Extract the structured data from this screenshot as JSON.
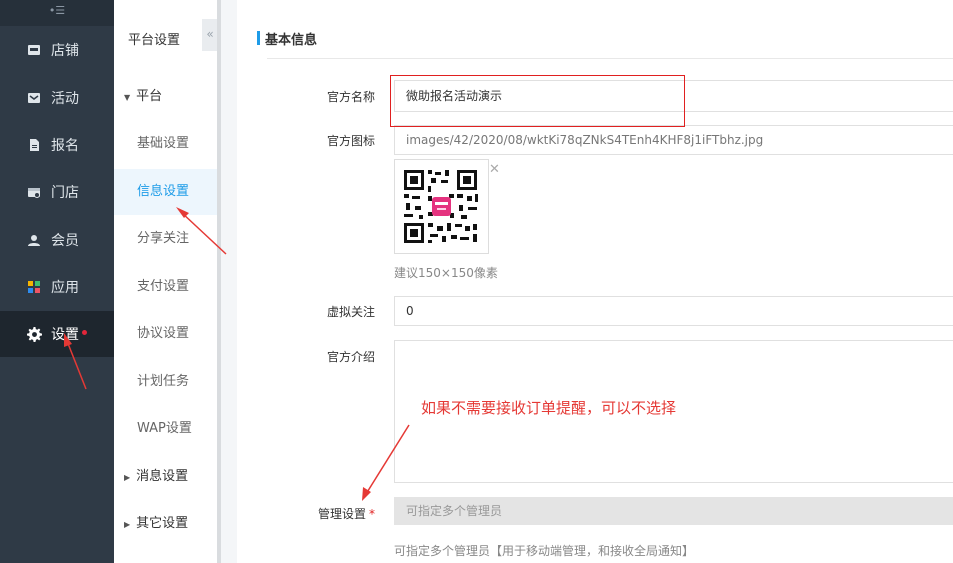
{
  "nav": {
    "collapse_label": "•☰",
    "items": [
      {
        "label": "店铺",
        "icon": "shop-icon"
      },
      {
        "label": "活动",
        "icon": "activity-icon"
      },
      {
        "label": "报名",
        "icon": "signup-icon"
      },
      {
        "label": "门店",
        "icon": "store-icon"
      },
      {
        "label": "会员",
        "icon": "member-icon"
      },
      {
        "label": "应用",
        "icon": "apps-icon"
      },
      {
        "label": "设置",
        "icon": "gear-icon",
        "active": true
      }
    ]
  },
  "submenu": {
    "title": "平台设置",
    "collapse_glyph": "«",
    "group_platform": "平台",
    "items": [
      "基础设置",
      "信息设置",
      "分享关注",
      "支付设置",
      "协议设置",
      "计划任务",
      "WAP设置"
    ],
    "active_index": 1,
    "group_message": "消息设置",
    "group_other": "其它设置"
  },
  "section": {
    "title": "基本信息"
  },
  "form": {
    "official_name": {
      "label": "官方名称",
      "value": "微助报名活动演示"
    },
    "official_icon": {
      "label": "官方图标",
      "value": "images/42/2020/08/wktKi78qZNkS4TEnh4KHF8j1iFTbhz.jpg",
      "close": "✕",
      "hint": "建议150×150像素"
    },
    "virtual_follow": {
      "label": "虚拟关注",
      "value": "0"
    },
    "official_intro": {
      "label": "官方介绍",
      "value": ""
    },
    "admin": {
      "label": "管理设置",
      "required_mark": "*",
      "placeholder": "可指定多个管理员",
      "hint": "可指定多个管理员【用于移动端管理，和接收全局通知】"
    }
  },
  "annotation": {
    "text": "如果不需要接收订单提醒，可以不选择"
  },
  "colors": {
    "accent": "#1e9ce8",
    "annotation_red": "#e53935",
    "sidebar": "#2f3a46"
  }
}
